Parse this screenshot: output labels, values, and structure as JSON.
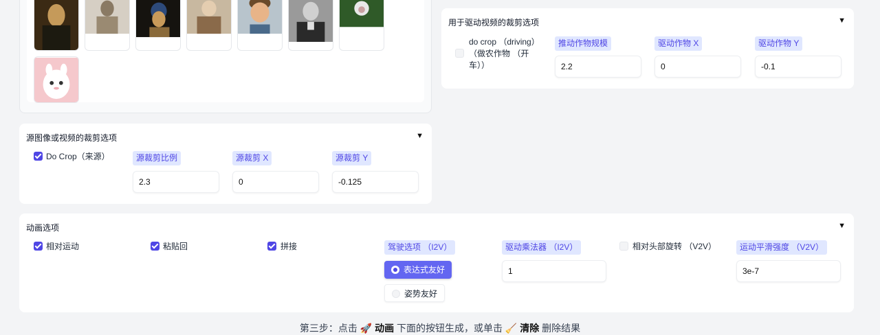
{
  "gallery": {
    "images": [
      {
        "name": "mona-lisa",
        "colors": [
          "#3b2a14",
          "#7a5a2a",
          "#1c1a10"
        ]
      },
      {
        "name": "terracotta-warrior",
        "colors": [
          "#d6cfc4",
          "#8a7a64",
          "#b2a894"
        ]
      },
      {
        "name": "girl-with-pearl-earring",
        "colors": [
          "#15130f",
          "#2d4a7a",
          "#c89a5a"
        ]
      },
      {
        "name": "girl-portrait",
        "colors": [
          "#c8b8a0",
          "#8a6a4a",
          "#d0c0a8"
        ]
      },
      {
        "name": "cartoon-boy",
        "colors": [
          "#b8c4cc",
          "#d89a6a",
          "#6a4a2a"
        ]
      },
      {
        "name": "man-photo",
        "colors": [
          "#9a9a9a",
          "#2a2a2a",
          "#e0e0e0"
        ]
      },
      {
        "name": "white-monkey",
        "colors": [
          "#2f5a28",
          "#e8e8e8",
          "#4a7a3a"
        ]
      },
      {
        "name": "alpaca",
        "colors": [
          "#f5c8cc",
          "#ffffff",
          "#f0b0b8"
        ]
      }
    ]
  },
  "source_crop": {
    "title": "源图像或视频的裁剪选项",
    "checkbox": {
      "label": "Do Crop（来源）",
      "checked": true
    },
    "fields": [
      {
        "label": "源裁剪比例",
        "value": "2.3"
      },
      {
        "label": "源裁剪 X",
        "value": "0"
      },
      {
        "label": "源裁剪 Y",
        "value": "-0.125"
      }
    ]
  },
  "driving_crop": {
    "title": "用于驱动视频的裁剪选项",
    "checkbox": {
      "line1": "do crop （driving）",
      "line2": "（做农作物 （开",
      "line3": "车））",
      "checked": false
    },
    "fields": [
      {
        "label": "推动作物规模",
        "value": "2.2"
      },
      {
        "label": "驱动作物 X",
        "value": "0"
      },
      {
        "label": "驱动作物 Y",
        "value": "-0.1"
      }
    ]
  },
  "animation": {
    "title": "动画选项",
    "checkboxes": [
      {
        "label": "相对运动",
        "checked": true
      },
      {
        "label": "粘贴回",
        "checked": true
      },
      {
        "label": "拼接",
        "checked": true
      }
    ],
    "driving_option": {
      "label": "驾驶选项 （I2V）",
      "options": [
        "表达式友好",
        "姿势友好"
      ],
      "selected": "表达式友好"
    },
    "multiplier": {
      "label": "驱动乘法器 （I2V）",
      "value": "1"
    },
    "head_rotation": {
      "label": "相对头部旋转 （V2V）",
      "checked": false
    },
    "smooth": {
      "label": "运动平滑强度 （V2V）",
      "value": "3e-7"
    }
  },
  "footer": {
    "t1": "第三步：点击",
    "t2": "动画",
    "t3": "下面的按钮生成，或单击",
    "t4": "清除",
    "t5": "删除结果"
  },
  "colors": {
    "accent": "#4f46e5",
    "tag_bg": "#e0e7ff",
    "panel_bg": "#ffffff",
    "page_bg": "#f3f4f6"
  }
}
